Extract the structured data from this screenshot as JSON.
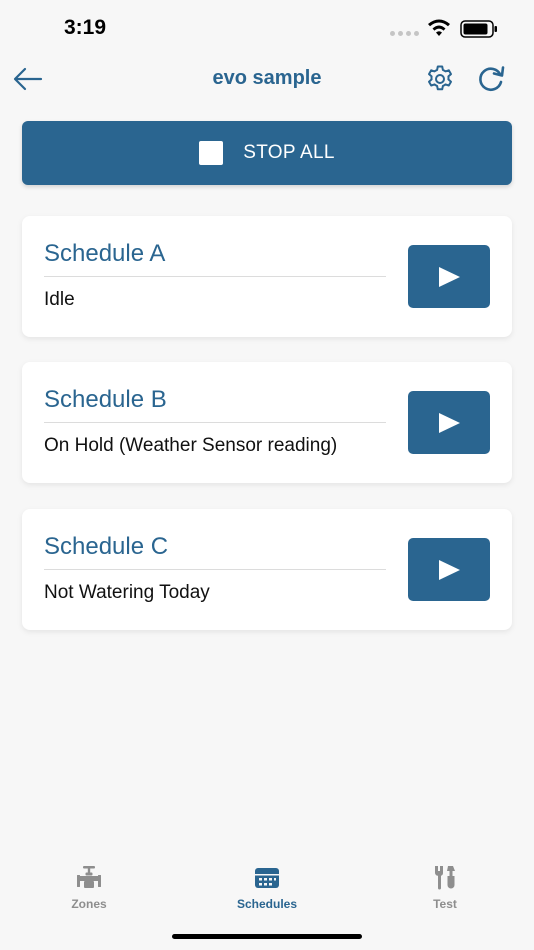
{
  "status_bar": {
    "time": "3:19"
  },
  "nav": {
    "title": "evo sample",
    "back_icon": "arrow-left-icon",
    "settings_icon": "gear-icon",
    "refresh_icon": "refresh-icon"
  },
  "stop_all": {
    "label": "STOP ALL",
    "icon": "stop-square-icon"
  },
  "schedules": [
    {
      "name": "Schedule A",
      "status": "Idle"
    },
    {
      "name": "Schedule B",
      "status": "On Hold (Weather Sensor reading)"
    },
    {
      "name": "Schedule C",
      "status": "Not Watering Today"
    }
  ],
  "tabs": [
    {
      "label": "Zones",
      "icon": "faucet-icon",
      "active": false
    },
    {
      "label": "Schedules",
      "icon": "calendar-icon",
      "active": true
    },
    {
      "label": "Test",
      "icon": "tools-icon",
      "active": false
    }
  ],
  "colors": {
    "accent": "#2a6590",
    "background": "#f7f7f7",
    "card": "#ffffff",
    "inactive_tab": "#8e8e8e"
  }
}
